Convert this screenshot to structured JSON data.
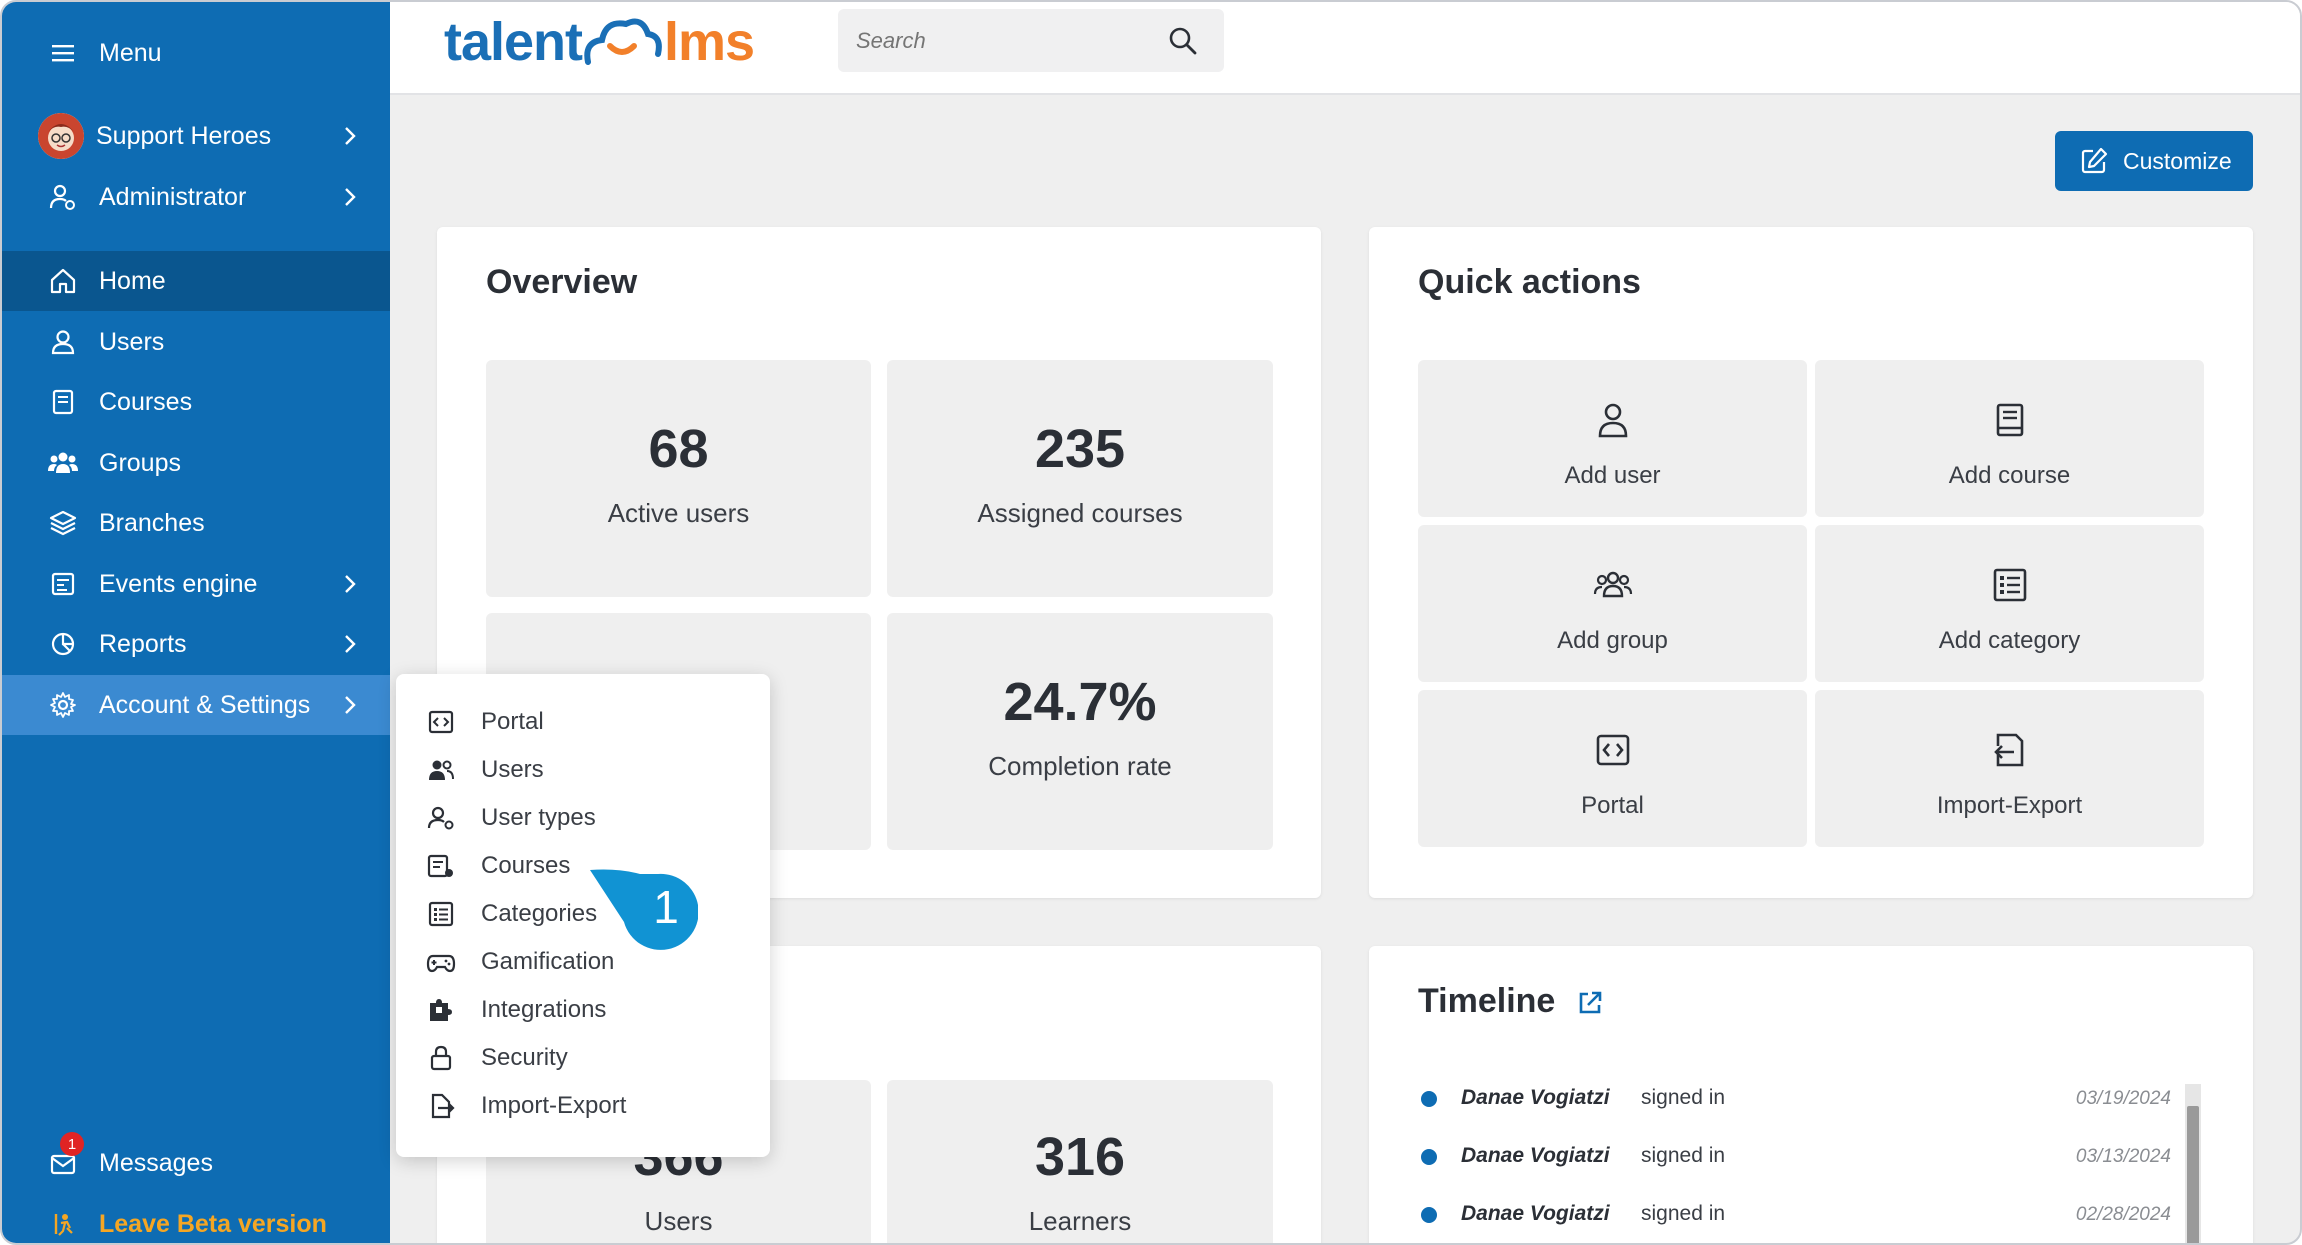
{
  "sidebar": {
    "menu_label": "Menu",
    "account_name": "Support Heroes",
    "role": "Administrator",
    "items": [
      {
        "label": "Home",
        "icon": "home-icon"
      },
      {
        "label": "Users",
        "icon": "user-icon"
      },
      {
        "label": "Courses",
        "icon": "book-icon"
      },
      {
        "label": "Groups",
        "icon": "group-icon"
      },
      {
        "label": "Branches",
        "icon": "layers-icon"
      },
      {
        "label": "Events engine",
        "icon": "events-icon"
      },
      {
        "label": "Reports",
        "icon": "pie-chart-icon"
      },
      {
        "label": "Account & Settings",
        "icon": "gear-icon"
      }
    ],
    "messages_label": "Messages",
    "messages_count": "1",
    "leave_beta_label": "Leave Beta version"
  },
  "header": {
    "logo_part1": "talent",
    "logo_part2": "lms",
    "search_placeholder": "Search"
  },
  "toolbar": {
    "customize_label": "Customize"
  },
  "overview": {
    "title": "Overview",
    "tiles": [
      {
        "value": "68",
        "caption": "Active users"
      },
      {
        "value": "235",
        "caption": "Assigned courses"
      },
      {
        "value": "24.7%",
        "caption": "Completion rate"
      }
    ],
    "bottom_tiles": [
      {
        "value": "366",
        "caption": "Users"
      },
      {
        "value": "316",
        "caption": "Learners"
      }
    ]
  },
  "quick_actions": {
    "title": "Quick actions",
    "items": [
      {
        "label": "Add user",
        "icon": "add-user-icon"
      },
      {
        "label": "Add course",
        "icon": "add-course-icon"
      },
      {
        "label": "Add group",
        "icon": "add-group-icon"
      },
      {
        "label": "Add category",
        "icon": "add-category-icon"
      },
      {
        "label": "Portal",
        "icon": "portal-icon"
      },
      {
        "label": "Import-Export",
        "icon": "import-export-icon"
      }
    ]
  },
  "dropdown": {
    "items": [
      {
        "label": "Portal",
        "icon": "portal-icon"
      },
      {
        "label": "Users",
        "icon": "users-icon"
      },
      {
        "label": "User types",
        "icon": "user-types-icon"
      },
      {
        "label": "Courses",
        "icon": "courses-settings-icon"
      },
      {
        "label": "Categories",
        "icon": "categories-icon"
      },
      {
        "label": "Gamification",
        "icon": "gamepad-icon"
      },
      {
        "label": "Integrations",
        "icon": "puzzle-icon"
      },
      {
        "label": "Security",
        "icon": "lock-icon"
      },
      {
        "label": "Import-Export",
        "icon": "import-export-icon"
      }
    ]
  },
  "step_marker": "1",
  "timeline": {
    "title": "Timeline",
    "entries": [
      {
        "user": "Danae Vogiatzi",
        "action": "signed in",
        "date": "03/19/2024"
      },
      {
        "user": "Danae Vogiatzi",
        "action": "signed in",
        "date": "03/13/2024"
      },
      {
        "user": "Danae Vogiatzi",
        "action": "signed in",
        "date": "02/28/2024"
      }
    ]
  },
  "colors": {
    "sidebar": "#0e6cb3",
    "sidebar_active": "#0a568f",
    "sidebar_hover": "#3b8ad1",
    "brand_orange": "#f2802a",
    "beta_label": "#f5a623"
  }
}
